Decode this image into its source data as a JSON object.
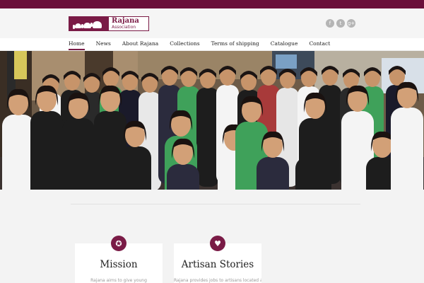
{
  "brand": {
    "title": "Rajana",
    "subtitle": "Association",
    "color": "#7a1b46"
  },
  "social": [
    {
      "icon": "facebook-icon",
      "glyph": "f"
    },
    {
      "icon": "twitter-icon",
      "glyph": "t"
    },
    {
      "icon": "google-plus-icon",
      "glyph": "g+"
    }
  ],
  "nav": {
    "items": [
      "Home",
      "News",
      "About Rajana",
      "Collections",
      "Terms of shipping",
      "Catalogue",
      "Contact"
    ],
    "active": "Home"
  },
  "hero": {
    "alt": "Group photo of Rajana artisans"
  },
  "features": [
    {
      "title": "Mission",
      "text": "Rajana aims to give young",
      "icon": "award-icon",
      "glyph": "✪"
    },
    {
      "title": "Artisan Stories",
      "text": "Rajana provides jobs to artisans located all",
      "icon": "heart-icon",
      "glyph": "♥"
    }
  ]
}
